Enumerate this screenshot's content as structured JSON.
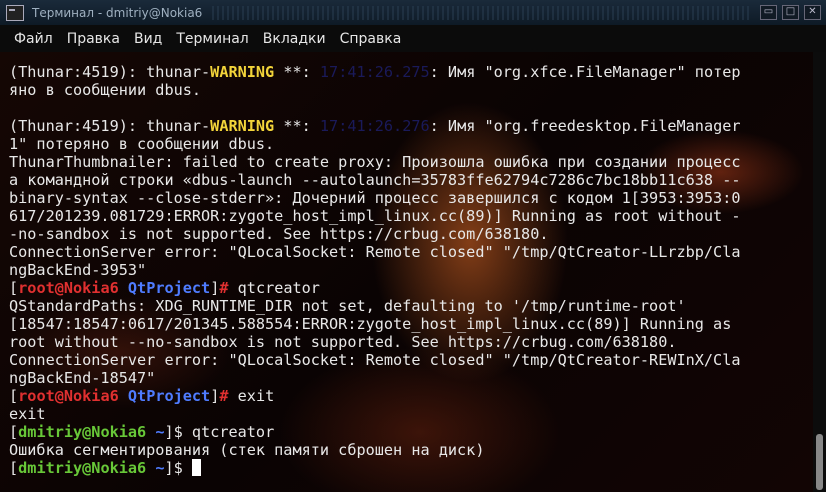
{
  "window": {
    "title": "Терминал - dmitriy@Nokia6",
    "buttons": [
      "▭",
      "□",
      "✕"
    ]
  },
  "menu": [
    "Файл",
    "Правка",
    "Вид",
    "Терминал",
    "Вкладки",
    "Справка"
  ],
  "terminal": {
    "lines": [
      {
        "segments": [
          {
            "t": "(Thunar:4519): thunar-"
          },
          {
            "t": "WARNING",
            "c": "warn"
          },
          {
            "t": " **: "
          },
          {
            "t": "17:41:26.275",
            "c": "dim"
          },
          {
            "t": ": Имя \"org.xfce.FileManager\" потер"
          }
        ]
      },
      {
        "segments": [
          {
            "t": "яно в сообщении dbus."
          }
        ]
      },
      {
        "segments": [
          {
            "t": ""
          }
        ]
      },
      {
        "segments": [
          {
            "t": "(Thunar:4519): thunar-"
          },
          {
            "t": "WARNING",
            "c": "warn"
          },
          {
            "t": " **: "
          },
          {
            "t": "17:41:26.276",
            "c": "dim"
          },
          {
            "t": ": Имя \"org.freedesktop.FileManager"
          }
        ]
      },
      {
        "segments": [
          {
            "t": "1\" потеряно в сообщении dbus."
          }
        ]
      },
      {
        "segments": [
          {
            "t": "ThunarThumbnailer: failed to create proxy: Произошла ошибка при создании процесс"
          }
        ]
      },
      {
        "segments": [
          {
            "t": "а командной строки «dbus-launch --autolaunch=35783ffe62794c7286c7bc18bb11c638 --"
          }
        ]
      },
      {
        "segments": [
          {
            "t": "binary-syntax --close-stderr»: Дочерний процесс завершился с кодом 1[3953:3953:0"
          }
        ]
      },
      {
        "segments": [
          {
            "t": "617/201239.081729:ERROR:zygote_host_impl_linux.cc(89)] Running as root without -"
          }
        ]
      },
      {
        "segments": [
          {
            "t": "-no-sandbox is not supported. See https://crbug.com/638180."
          }
        ]
      },
      {
        "segments": [
          {
            "t": "ConnectionServer error: \"QLocalSocket: Remote closed\" \"/tmp/QtCreator-LLrzbp/Cla"
          }
        ]
      },
      {
        "segments": [
          {
            "t": "ngBackEnd-3953\""
          }
        ]
      },
      {
        "segments": [
          {
            "t": "["
          },
          {
            "t": "root@Nokia6",
            "c": "red"
          },
          {
            "t": " "
          },
          {
            "t": "QtProject",
            "c": "blue"
          },
          {
            "t": "]"
          },
          {
            "t": "#",
            "c": "red"
          },
          {
            "t": " qtcreator"
          }
        ]
      },
      {
        "segments": [
          {
            "t": "QStandardPaths: XDG_RUNTIME_DIR not set, defaulting to '/tmp/runtime-root'"
          }
        ]
      },
      {
        "segments": [
          {
            "t": "[18547:18547:0617/201345.588554:ERROR:zygote_host_impl_linux.cc(89)] Running as"
          }
        ]
      },
      {
        "segments": [
          {
            "t": "root without --no-sandbox is not supported. See https://crbug.com/638180."
          }
        ]
      },
      {
        "segments": [
          {
            "t": "ConnectionServer error: \"QLocalSocket: Remote closed\" \"/tmp/QtCreator-REWInX/Cla"
          }
        ]
      },
      {
        "segments": [
          {
            "t": "ngBackEnd-18547\""
          }
        ]
      },
      {
        "segments": [
          {
            "t": "["
          },
          {
            "t": "root@Nokia6",
            "c": "red"
          },
          {
            "t": " "
          },
          {
            "t": "QtProject",
            "c": "blue"
          },
          {
            "t": "]"
          },
          {
            "t": "#",
            "c": "red"
          },
          {
            "t": " exit"
          }
        ]
      },
      {
        "segments": [
          {
            "t": "exit"
          }
        ]
      },
      {
        "segments": [
          {
            "t": "["
          },
          {
            "t": "dmitriy@Nokia6",
            "c": "green"
          },
          {
            "t": " "
          },
          {
            "t": "~",
            "c": "blue"
          },
          {
            "t": "]$ qtcreator"
          }
        ]
      },
      {
        "segments": [
          {
            "t": "Ошибка сегментирования (стек памяти сброшен на диск)"
          }
        ]
      },
      {
        "segments": [
          {
            "t": "["
          },
          {
            "t": "dmitriy@Nokia6",
            "c": "green"
          },
          {
            "t": " "
          },
          {
            "t": "~",
            "c": "blue"
          },
          {
            "t": "]$ "
          }
        ],
        "cursor": true
      }
    ]
  }
}
